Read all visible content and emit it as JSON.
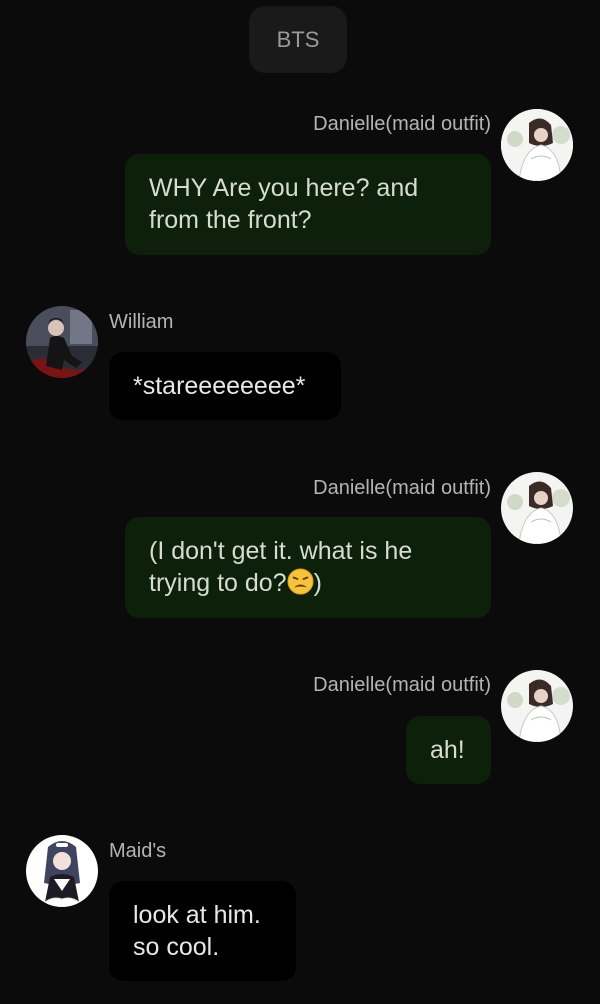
{
  "header": {
    "chip_label": "BTS"
  },
  "messages": [
    {
      "sender": "Danielle(maid outfit)",
      "text": "WHY Are you here? and from the front?",
      "avatar": "danielle-avatar"
    },
    {
      "sender": "William",
      "text": "*stareeeeeeee*",
      "avatar": "william-avatar"
    },
    {
      "sender": "Danielle(maid outfit)",
      "text_before_emoji": "(I don't get it. what is he trying to do?",
      "emoji": "weary-face-emoji",
      "text_after_emoji": ")",
      "avatar": "danielle-avatar"
    },
    {
      "sender": "Danielle(maid outfit)",
      "text": "ah!",
      "avatar": "danielle-avatar"
    },
    {
      "sender": "Maid's",
      "text": "look at him. so cool.",
      "avatar": "maid-avatar"
    }
  ],
  "colors": {
    "background": "#0b0b0b",
    "sent_bubble": "#0d200a",
    "received_bubble": "#000000",
    "header_chip": "#1a1a1a",
    "name_text": "#b4b4b4"
  }
}
